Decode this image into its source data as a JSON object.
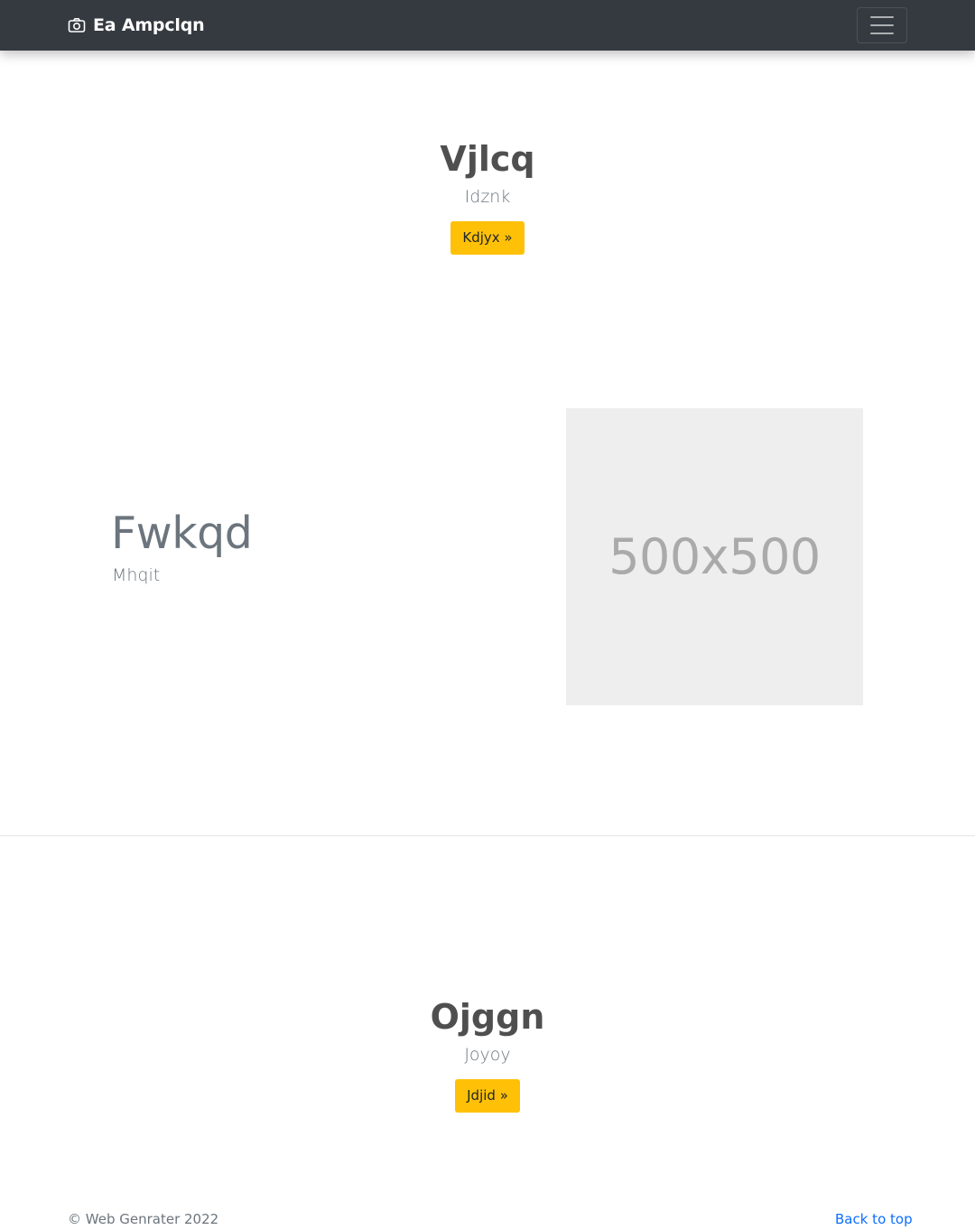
{
  "navbar": {
    "brand_icon": "camera-icon",
    "brand": "Ea Ampclqn",
    "toggler_icon": "hamburger-menu-icon"
  },
  "hero_top": {
    "heading": "Vjlcq",
    "lead": "Idznk",
    "button": "Kdjyx »"
  },
  "feature": {
    "heading": "Fwkqd",
    "subheading": "Mhqit",
    "image_placeholder": "500x500"
  },
  "hero_bottom": {
    "heading": "Ojggn",
    "lead": "Joyoy",
    "button": "Jdjid »"
  },
  "footer": {
    "copyright": "© Web Genrater 2022",
    "back_to_top": "Back to top"
  },
  "colors": {
    "navbar_bg": "#343a40",
    "button_bg": "#ffc107",
    "link": "#0d6efd",
    "placeholder_bg": "#eeeeee"
  }
}
